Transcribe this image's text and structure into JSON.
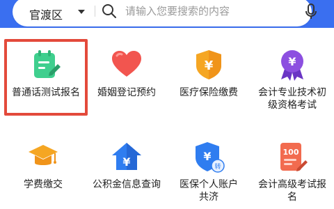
{
  "search": {
    "district": "官渡区",
    "placeholder": "请输入您要搜索的内容"
  },
  "services": [
    {
      "label": "普通话测试报名",
      "icon": "clipboard-edit-icon",
      "color": "#3fcf8e"
    },
    {
      "label": "婚姻登记预约",
      "icon": "heart-icon",
      "color": "#f2554f"
    },
    {
      "label": "医疗保险缴费",
      "icon": "yuan-shield-icon",
      "color": "#f5a623"
    },
    {
      "label": "会计专业技术初级资格考试",
      "icon": "yuan-badge-icon",
      "color": "#8c4fe0"
    },
    {
      "label": "学费缴交",
      "icon": "graduation-cap-icon",
      "color": "#f5a623"
    },
    {
      "label": "公积金信息查询",
      "icon": "yuan-house-icon",
      "color": "#2f7df0"
    },
    {
      "label": "医保个人账户共济",
      "icon": "yuan-transfer-shield-icon",
      "color": "#2f7df0"
    },
    {
      "label": "会计高级考试报名",
      "icon": "score-100-doc-icon",
      "color": "#f26b4f"
    }
  ],
  "highlight_color": "#e34a3b"
}
